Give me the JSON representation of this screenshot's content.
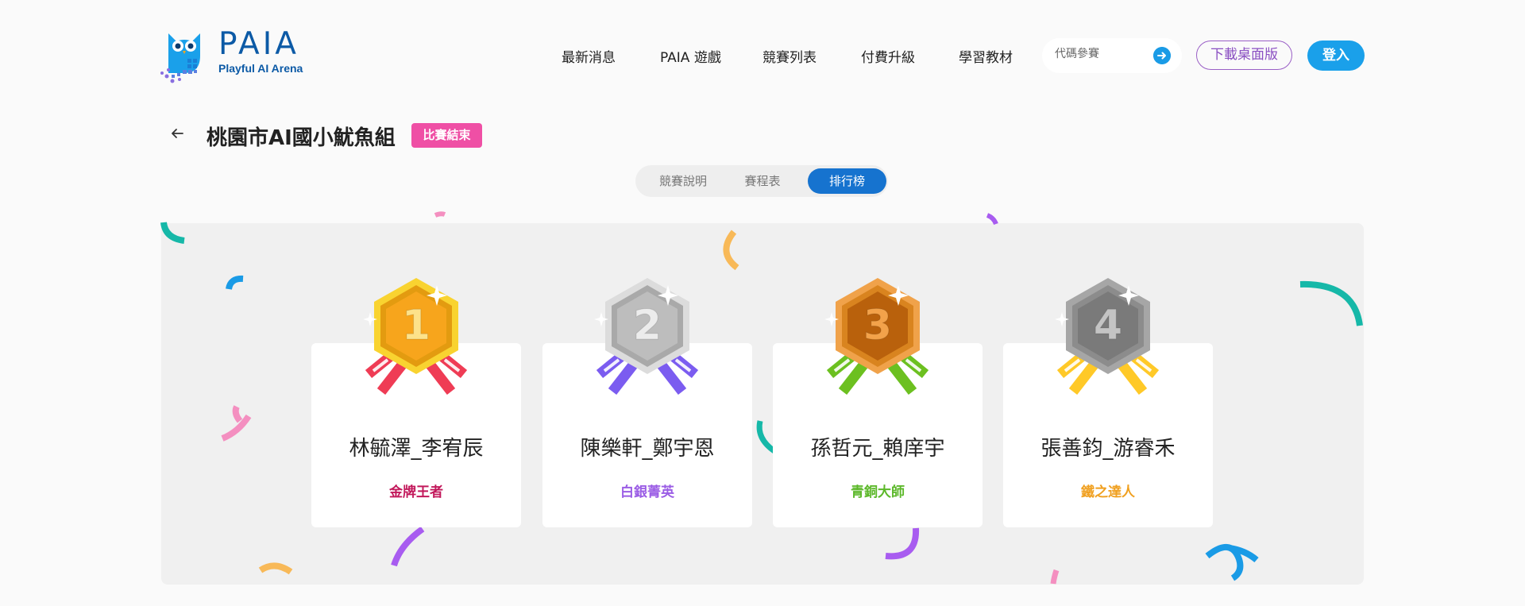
{
  "header": {
    "logo_title": "PAIA",
    "logo_subtitle": "Playful AI Arena",
    "nav": [
      "最新消息",
      "PAIA 遊戲",
      "競賽列表",
      "付費升級",
      "學習教材"
    ],
    "code_input_placeholder": "代碼參賽",
    "download_label": "下載桌面版",
    "login_label": "登入"
  },
  "competition": {
    "title": "桃園市AI國小魷魚組",
    "status": "比賽結束"
  },
  "tabs": [
    {
      "label": "競賽說明",
      "active": false
    },
    {
      "label": "賽程表",
      "active": false
    },
    {
      "label": "排行榜",
      "active": true
    }
  ],
  "leaderboard": [
    {
      "rank": "1",
      "name": "林毓澤_李宥辰",
      "title": "金牌王者",
      "title_color": "#c2185b",
      "ribbon_color": "#ef3c55",
      "medal_face": "#f7a51c",
      "medal_rim": "#f9d330",
      "medal_edge": "#e39b10",
      "digit_color": "#fde28a"
    },
    {
      "rank": "2",
      "name": "陳樂軒_鄭宇恩",
      "title": "白銀菁英",
      "title_color": "#9b5de5",
      "ribbon_color": "#7b5cf0",
      "medal_face": "#bdbdbd",
      "medal_rim": "#dcdcdc",
      "medal_edge": "#a9a9a9",
      "digit_color": "#ececec"
    },
    {
      "rank": "3",
      "name": "孫哲元_賴庠宇",
      "title": "青銅大師",
      "title_color": "#5cb82a",
      "ribbon_color": "#6cc020",
      "medal_face": "#b9610c",
      "medal_rim": "#f0a24a",
      "medal_edge": "#d9841f",
      "digit_color": "#f3a24a"
    },
    {
      "rank": "4",
      "name": "張善鈞_游睿禾",
      "title": "鐵之達人",
      "title_color": "#f0a020",
      "ribbon_color": "#ffc928",
      "medal_face": "#7a7a7a",
      "medal_rim": "#a6a6a6",
      "medal_edge": "#8c8c8c",
      "digit_color": "#c4c4c4"
    }
  ],
  "colors": {
    "brand_blue": "#0c5aa6",
    "accent_blue": "#1aa0ea",
    "tab_active": "#1673cf",
    "badge_pink": "#ef4fa5",
    "download_purple": "#9a5fc6"
  },
  "icons": [
    "owl-logo",
    "arrow-right-circle-icon",
    "back-arrow-icon",
    "medal-icon",
    "sparkle-icon"
  ]
}
